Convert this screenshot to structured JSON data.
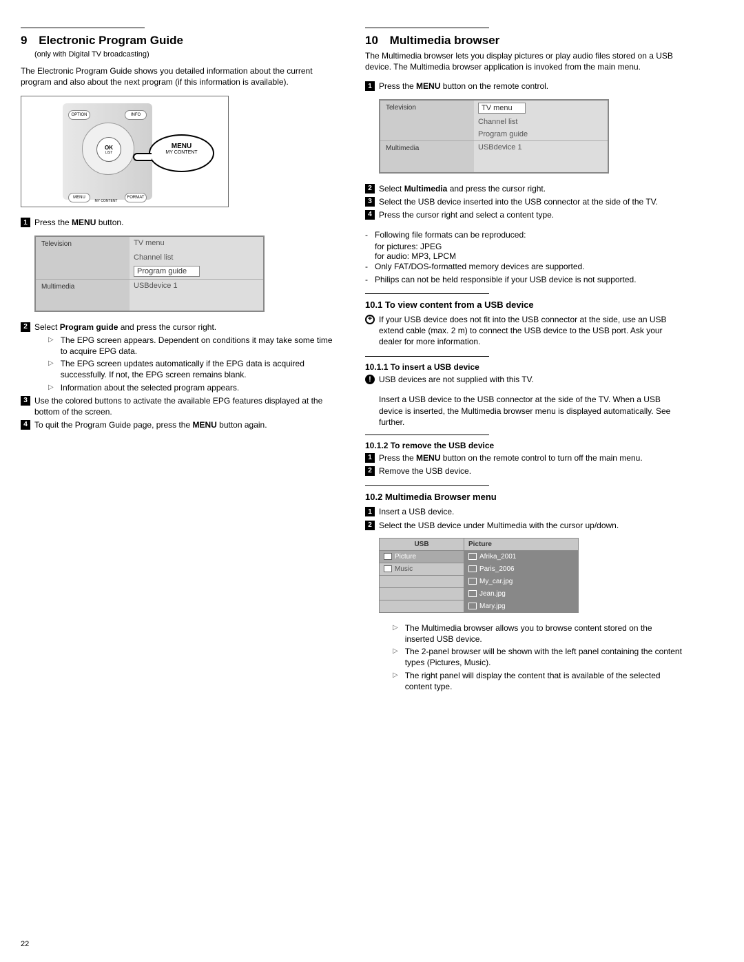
{
  "page_number": "22",
  "left": {
    "heading_num": "9",
    "heading": "Electronic Program Guide",
    "subtitle": "(only with Digital TV broadcasting)",
    "intro": "The Electronic Program Guide shows you detailed information about the current program and also about the next program (if this information is available).",
    "remote": {
      "option": "OPTION",
      "info": "INFO",
      "ok": "OK",
      "ok_sub": "LIST",
      "menu_b": "MENU",
      "format": "FORMAT",
      "mycontent": "MY CONTENT",
      "bubble_label": "MENU",
      "bubble_sub": "MY CONTENT"
    },
    "step1_pre": "Press the ",
    "step1_bold": "MENU",
    "step1_post": " button.",
    "menu": {
      "television": "Television",
      "tvmenu": "TV menu",
      "channellist": "Channel list",
      "programguide": "Program guide",
      "multimedia": "Multimedia",
      "usbdevice": "USBdevice 1"
    },
    "step2_pre": "Select ",
    "step2_bold": "Program guide",
    "step2_post": " and press the cursor right.",
    "sub2a": "The EPG screen appears. Dependent on conditions it may take some time to acquire EPG data.",
    "sub2b": "The EPG screen updates automatically if the EPG data is acquired successfully. If not, the EPG screen remains blank.",
    "sub2c": "Information about the selected program appears.",
    "step3": "Use the colored buttons to activate the available EPG features displayed at the bottom of the screen.",
    "step4_pre": "To quit the Program Guide page, press the ",
    "step4_bold": "MENU",
    "step4_post": " button again."
  },
  "right": {
    "heading_num": "10",
    "heading": "Multimedia browser",
    "intro": "The Multimedia browser lets you display pictures or play audio files stored on a USB device. The Multimedia browser application is invoked from the main menu.",
    "step1_pre": "Press the ",
    "step1_bold": "MENU",
    "step1_post": " button on the remote control.",
    "menu": {
      "television": "Television",
      "tvmenu": "TV menu",
      "channellist": "Channel list",
      "programguide": "Program guide",
      "multimedia": "Multimedia",
      "usbdevice": "USBdevice 1"
    },
    "step2_pre": "Select ",
    "step2_bold": "Multimedia",
    "step2_post": " and press the cursor right.",
    "step3": " Select the USB device inserted into the USB connector at the side of the TV.",
    "step4": "Press the cursor right and select a content type.",
    "dash1a": "Following file formats can be reproduced:",
    "dash1b": "for pictures: JPEG",
    "dash1c": "for audio: MP3, LPCM",
    "dash2": "Only FAT/DOS-formatted memory devices are supported.",
    "dash3": "Philips can not be held responsible if your USB device is not supported.",
    "h101": "10.1 To view content from a USB device",
    "tip101": "If your USB device does not fit into the USB connector at the side, use an USB extend cable (max. 2 m) to connect the USB device to the USB port. Ask your dealer for more information.",
    "h1011": "10.1.1 To insert a USB device",
    "warn1011": "USB devices are not supplied with this TV.",
    "para1011": "Insert a USB device to the USB connector at the side of the TV. When a USB device is inserted, the Multimedia browser menu is displayed automatically. See further.",
    "h1012": "10.1.2 To remove the USB device",
    "step1012_1_pre": "Press the ",
    "step1012_1_bold": "MENU",
    "step1012_1_post": " button on the remote control to turn off the main menu.",
    "step1012_2": "Remove the USB device.",
    "h102": "10.2 Multimedia Browser menu",
    "step102_1": "Insert a USB device.",
    "step102_2": "Select the USB device under Multimedia with the cursor up/down.",
    "usb": {
      "hdr_l": "USB",
      "hdr_r": "Picture",
      "picture": "Picture",
      "music": "Music",
      "r1": "Afrika_2001",
      "r2": "Paris_2006",
      "r3": "My_car.jpg",
      "r4": "Jean.jpg",
      "r5": "Mary.jpg"
    },
    "sub102a": "The Multimedia browser allows you to browse content stored on the inserted USB device.",
    "sub102b": "The 2-panel browser will be shown with the left panel containing the content types (Pictures, Music).",
    "sub102c": "The right panel will display the content that is available of the selected content type."
  }
}
